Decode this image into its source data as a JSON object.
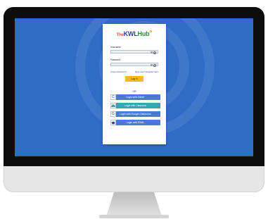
{
  "logo": {
    "the": "The",
    "kwl": "KWL",
    "hub": "Hub"
  },
  "form": {
    "username_label": "Username",
    "password_label": "Password",
    "forgot_password": "Forgot Password",
    "register": "New user? Register here",
    "login_button": "Log in",
    "or_text": "OR"
  },
  "sso": {
    "clever": "Login with Clever",
    "classlink": "Login with ClassLink",
    "google_classroom": "Login with Google Classroom",
    "ssml": "Login with SSML"
  },
  "colors": {
    "screen": "#2f6cc5",
    "button_blue": "#4a7ad6",
    "classlink_teal": "#37a3b5",
    "login_yellow": "#f7b916"
  }
}
